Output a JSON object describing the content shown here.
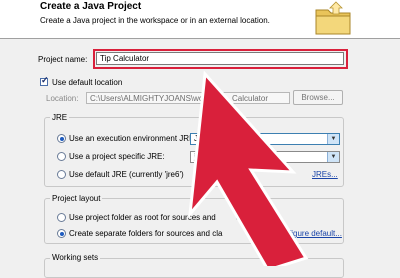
{
  "header": {
    "title": "Create a Java Project",
    "description": "Create a Java project in the workspace or in an external location."
  },
  "project_name": {
    "label": "Project name:",
    "value": "Tip Calculator"
  },
  "default_location": {
    "label": "Use default location",
    "checked": true
  },
  "location": {
    "label": "Location:",
    "value_left": "C:\\Users\\ALMIGHTYJOANS\\worksp",
    "value_right": "Calculator",
    "browse_label": "Browse..."
  },
  "jre": {
    "group_title": "JRE",
    "option1": "Use an execution environment JRE:",
    "option1_value": "Jav",
    "option2": "Use a project specific JRE:",
    "option2_value": "jre6",
    "option3": "Use default JRE (currently 'jre6')",
    "configure_link": "JREs..."
  },
  "layout": {
    "group_title": "Project layout",
    "option1": "Use project folder as root for sources and",
    "option1_tail": "es",
    "option2": "Create separate folders for sources and cla",
    "option2_tail": "iles",
    "configure_link": "figure default..."
  },
  "working_sets": {
    "group_title": "Working sets"
  },
  "colors": {
    "highlight": "#d9203b",
    "arrow": "#d9203b"
  }
}
